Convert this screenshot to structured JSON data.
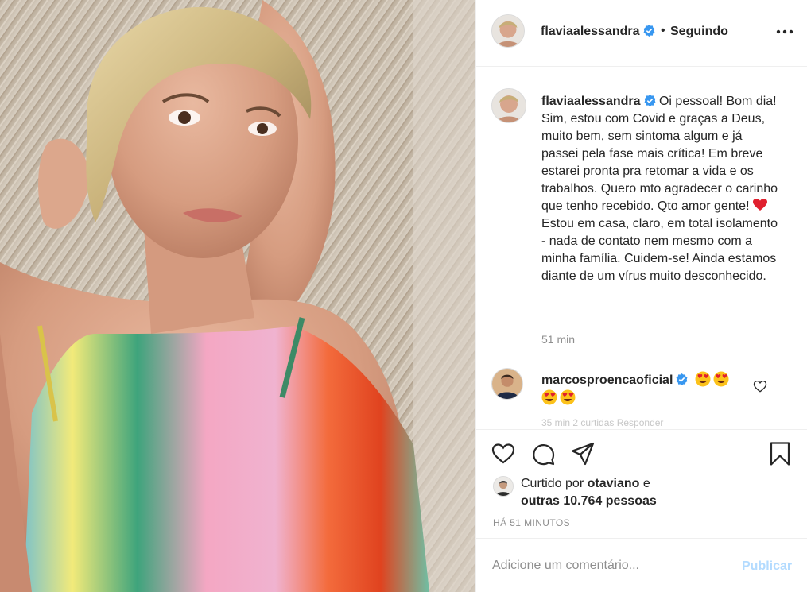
{
  "post": {
    "username": "flaviaalessandra",
    "separator": "•",
    "follow_state": "Seguindo",
    "more_icon": "more-horizontal-icon"
  },
  "caption": {
    "username": "flaviaalessandra",
    "text_before_heart": "Oi pessoal! Bom dia! Sim, estou com Covid e graças a Deus, muito bem, sem sintoma algum e já passei pela fase mais crítica! Em breve estarei pronta pra retomar a vida e os trabalhos. Quero mto agradecer o carinho que tenho recebido. Qto amor gente!",
    "text_after_heart": "Estou em casa, claro, em total isolamento - nada de contato nem mesmo com a minha família. Cuidem-se! Ainda estamos diante de um vírus muito desconhecido.",
    "time": "51 min"
  },
  "comment": {
    "username": "marcosproencaoficial",
    "emoji": "heart-eyes",
    "emoji_count": 4,
    "meta": "35 min   2 curtidas   Responder"
  },
  "likes": {
    "prefix": "Curtido por",
    "user": "otaviano",
    "conj": "e",
    "others": "outras 10.764 pessoas"
  },
  "timestamp": "HÁ 51 MINUTOS",
  "add_comment": {
    "placeholder": "Adicione um comentário...",
    "publish_label": "Publicar"
  },
  "colors": {
    "text": "#262626",
    "secondary": "#8e8e8e",
    "verified": "#3897f0",
    "publish_disabled": "#b3dbff",
    "border": "#efefef"
  }
}
